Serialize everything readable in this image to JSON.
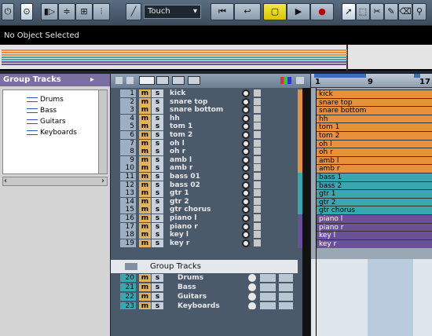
{
  "toolbar": {
    "automation_mode": "Touch"
  },
  "infoline": {
    "text": "No Object Selected"
  },
  "inspector": {
    "title": "Group Tracks",
    "tree": [
      "Drums",
      "Bass",
      "Guitars",
      "Keyboards"
    ]
  },
  "group_folder": {
    "label": "Group Tracks"
  },
  "tracks": [
    {
      "n": "1",
      "name": "kick",
      "color": "#e8903a"
    },
    {
      "n": "2",
      "name": "snare top",
      "color": "#e8903a"
    },
    {
      "n": "3",
      "name": "snare bottom",
      "color": "#e8903a"
    },
    {
      "n": "4",
      "name": "hh",
      "color": "#e8903a"
    },
    {
      "n": "5",
      "name": "tom 1",
      "color": "#e8903a"
    },
    {
      "n": "6",
      "name": "tom 2",
      "color": "#e8903a"
    },
    {
      "n": "7",
      "name": "oh l",
      "color": "#e8903a"
    },
    {
      "n": "8",
      "name": "oh r",
      "color": "#e8903a"
    },
    {
      "n": "9",
      "name": "amb l",
      "color": "#e8903a"
    },
    {
      "n": "10",
      "name": "amb r",
      "color": "#e8903a"
    },
    {
      "n": "11",
      "name": "bass 01",
      "color": "#3aa6b0"
    },
    {
      "n": "12",
      "name": "bass 02",
      "color": "#3aa6b0"
    },
    {
      "n": "13",
      "name": "gtr 1",
      "color": "#3aa6b0"
    },
    {
      "n": "14",
      "name": "gtr 2",
      "color": "#3aa6b0"
    },
    {
      "n": "15",
      "name": "gtr chorus",
      "color": "#3aa6b0"
    },
    {
      "n": "16",
      "name": "piano l",
      "color": "#6a5096"
    },
    {
      "n": "17",
      "name": "piano r",
      "color": "#6a5096"
    },
    {
      "n": "18",
      "name": "key l",
      "color": "#6a5096"
    },
    {
      "n": "19",
      "name": "key r",
      "color": "#6a5096"
    }
  ],
  "group_tracks": [
    {
      "n": "20",
      "name": "Drums"
    },
    {
      "n": "21",
      "name": "Bass"
    },
    {
      "n": "22",
      "name": "Guitars"
    },
    {
      "n": "23",
      "name": "Keyboards"
    }
  ],
  "parts": [
    "kick",
    "snare top",
    "snare bottom",
    "hh",
    "tom 1",
    "tom 2",
    "oh l",
    "oh r",
    "amb l",
    "amb r",
    "bass 1",
    "bass 2",
    "gtr 1",
    "gtr 2",
    "gtr chorus",
    "piano l",
    "piano r",
    "key l",
    "key r"
  ],
  "ruler": {
    "marks": [
      "1",
      "9",
      "17"
    ]
  },
  "buttons": {
    "m": "m",
    "s": "s"
  }
}
